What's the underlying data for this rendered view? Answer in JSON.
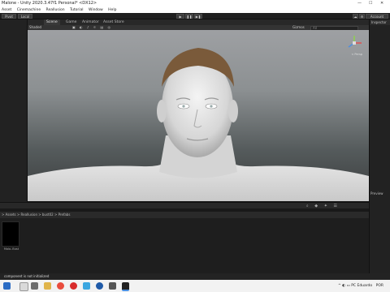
{
  "window": {
    "title": "Malone - Unity 2020.3.47f1 Personal* <DX12>",
    "controls": [
      "—",
      "☐",
      "✕"
    ]
  },
  "menu": {
    "items": [
      "Asset",
      "Cinemachine",
      "Reallusion",
      "Tutorial",
      "Window",
      "Help"
    ]
  },
  "toolbar": {
    "left_buttons": [
      "Pivot",
      "Local"
    ],
    "play": "▶",
    "pause": "❚❚",
    "step": "▶❚",
    "account_label": "Account"
  },
  "scene_tabs": [
    "Scene",
    "Game",
    "Animator",
    "Asset Store"
  ],
  "scene_toolbar": {
    "shading_mode": "Shaded",
    "gizmos_label": "Gizmos",
    "search_placeholder": "All"
  },
  "gizmo": {
    "label": "< Persp"
  },
  "right_panel": {
    "title": "Inspector",
    "section": "Preview"
  },
  "project": {
    "breadcrumb": "> Assets > Reallusion > bust02 > Prefabs",
    "assets": [
      {
        "name": "Malo..Bust"
      }
    ]
  },
  "status": {
    "message": "component is not initialized"
  },
  "taskbar": {
    "tray_text": "PC  Eduardo",
    "tray_flag": "POR"
  }
}
